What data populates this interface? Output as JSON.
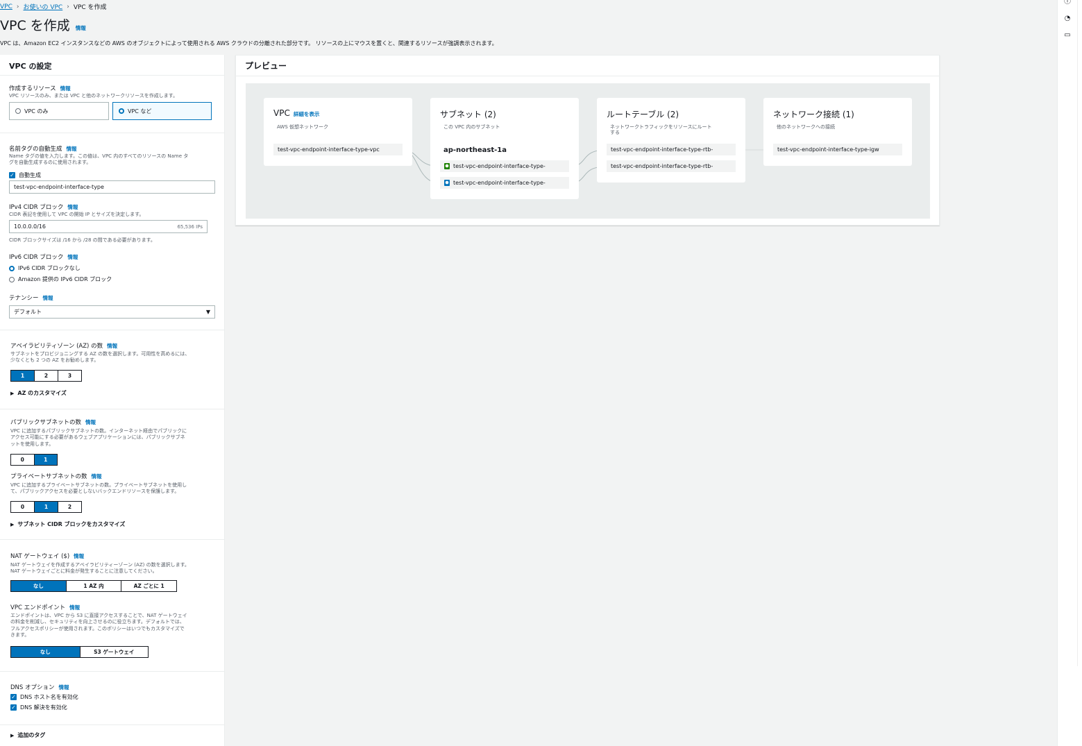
{
  "breadcrumb": {
    "items": [
      "VPC",
      "お使いの VPC",
      "VPC を作成"
    ]
  },
  "header": {
    "title": "VPC を作成",
    "info": "情報",
    "description": "VPC は、Amazon EC2 インスタンスなどの AWS のオブジェクトによって使用される AWS クラウドの分離された部分です。 リソースの上にマウスを置くと、関連するリソースが強調表示されます。"
  },
  "settings": {
    "title": "VPC の設定",
    "info": "情報",
    "resources": {
      "label": "作成するリソース",
      "desc": "VPC リソースのみ、または VPC と他のネットワークリソースを作成します。",
      "opt1": "VPC のみ",
      "opt2": "VPC など"
    },
    "nametag": {
      "label": "名前タグの自動生成",
      "desc1": "Name タグの値を入力します。この値は、VPC 内のすべてのリソースの Name タ",
      "desc2": "グを自動生成するのに使用されます。",
      "checkbox": "自動生成",
      "value": "test-vpc-endpoint-interface-type"
    },
    "ipv4": {
      "label": "IPv4 CIDR ブロック",
      "desc": "CIDR 表記を使用して VPC の開始 IP とサイズを決定します。",
      "value": "10.0.0.0/16",
      "suffix": "65,536 IPs",
      "hint": "CIDR ブロックサイズは /16 から /28 の間である必要があります。"
    },
    "ipv6": {
      "label": "IPv6 CIDR ブロック",
      "opt1": "IPv6 CIDR ブロックなし",
      "opt2": "Amazon 提供の IPv6 CIDR ブロック"
    },
    "tenancy": {
      "label": "テナンシー",
      "value": "デフォルト"
    },
    "az": {
      "label": "アベイラビリティゾーン (AZ) の数",
      "desc1": "サブネットをプロビジョニングする AZ の数を選択します。可用性を高めるには、",
      "desc2": "少なくとも 2 つの AZ をお勧めします。",
      "options": [
        "1",
        "2",
        "3"
      ],
      "customize": "AZ のカスタマイズ"
    },
    "public": {
      "label": "パブリックサブネットの数",
      "desc1": "VPC に追加するパブリックサブネットの数。インターネット経由でパブリックに",
      "desc2": "アクセス可能にする必要があるウェブアプリケーションには、パブリックサブネ",
      "desc3": "ットを使用します。",
      "options": [
        "0",
        "1"
      ]
    },
    "private": {
      "label": "プライベートサブネットの数",
      "desc1": "VPC に追加するプライベートサブネットの数。プライベートサブネットを使用し",
      "desc2": "て、パブリックアクセスを必要としないバックエンドリソースを保護します。",
      "options": [
        "0",
        "1",
        "2"
      ],
      "customize": "サブネット CIDR ブロックをカスタマイズ"
    },
    "nat": {
      "label": "NAT ゲートウェイ ($)",
      "desc1": "NAT ゲートウェイを作成するアベイラビリティーゾーン (AZ) の数を選択します。",
      "desc2": "NAT ゲートウェイごとに料金が発生することに注意してください。",
      "options": [
        "なし",
        "1 AZ 内",
        "AZ ごとに 1"
      ]
    },
    "endpoint": {
      "label": "VPC エンドポイント",
      "desc1": "エンドポイントは、VPC から S3 に直接アクセスすることで、NAT ゲートウェイ",
      "desc2": "の料金を削減し、セキュリティを向上させるのに役立ちます。デフォルトでは、",
      "desc3": "フルアクセスポリシーが使用されます。このポリシーはいつでもカスタマイズで",
      "desc4": "きます。",
      "options": [
        "なし",
        "S3 ゲートウェイ"
      ]
    },
    "dns": {
      "label": "DNS オプション",
      "opt1": "DNS ホスト名を有効化",
      "opt2": "DNS 解決を有効化"
    },
    "tags": {
      "label": "追加のタグ"
    }
  },
  "preview": {
    "title": "プレビュー",
    "vpc": {
      "title": "VPC",
      "link": "詳細を表示",
      "sub": "AWS 仮想ネットワーク",
      "item": "test-vpc-endpoint-interface-type-vpc"
    },
    "subnet": {
      "title": "サブネット (2)",
      "sub": "この VPC 内のサブネット",
      "az": "ap-northeast-1a",
      "items": [
        "test-vpc-endpoint-interface-type-",
        "test-vpc-endpoint-interface-type-"
      ]
    },
    "route": {
      "title": "ルートテーブル (2)",
      "sub1": "ネットワークトラフィックをリソースにルート",
      "sub2": "する",
      "items": [
        "test-vpc-endpoint-interface-type-rtb-",
        "test-vpc-endpoint-interface-type-rtb-"
      ]
    },
    "network": {
      "title": "ネットワーク接続 (1)",
      "sub": "他のネットワークへの接続",
      "item": "test-vpc-endpoint-interface-type-igw"
    }
  },
  "colors": {
    "accent": "#0073bb",
    "public_subnet": "#1d8102",
    "private_subnet": "#0073bb"
  }
}
